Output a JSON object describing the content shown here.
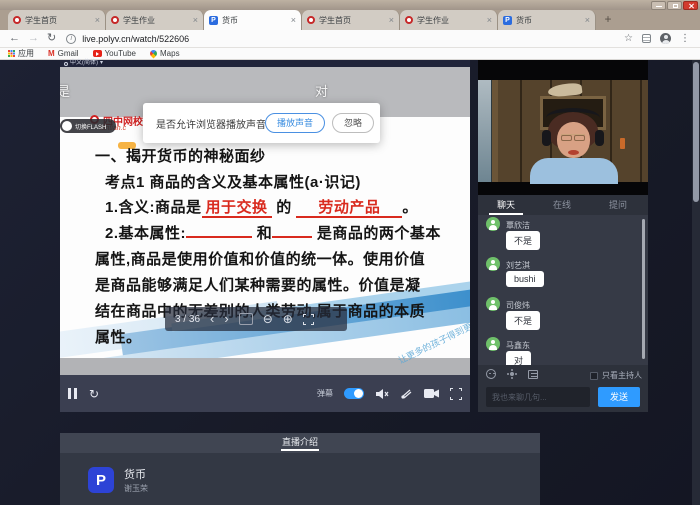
{
  "browser": {
    "tabs": [
      {
        "label": "学生首页"
      },
      {
        "label": "学生作业"
      },
      {
        "label": "货币"
      },
      {
        "label": "学生首页"
      },
      {
        "label": "学生作业"
      },
      {
        "label": "货币"
      }
    ],
    "url": "live.polyv.cn/watch/522606",
    "bookmarks": {
      "apps": "应用",
      "gmail": "Gmail",
      "youtube": "YouTube",
      "maps": "Maps",
      "gmail_letter": "M"
    }
  },
  "icons": {
    "back": "←",
    "forward": "→",
    "refresh": "↻",
    "info": "i",
    "star": "☆",
    "menu_dots": "⋮",
    "caret_down": "▾",
    "chevron_left": "‹",
    "chevron_right": "›",
    "zoom_out": "⊖",
    "zoom_in": "⊕",
    "close_tab": "×",
    "new_tab": "+"
  },
  "player": {
    "language": "中文(简体)",
    "danmaku": {
      "left_partial": "不是",
      "center": "对"
    },
    "flash_switch_label": "切换FLASH",
    "logo_text": "四中网校",
    "logo_domain": "lantian.c",
    "audio_dialog": {
      "question": "是否允许浏览器播放声音？",
      "play_button": "播放声音",
      "ignore_button": "忽略"
    },
    "slide": {
      "title": "一、揭开货币的神秘面纱",
      "subtitle": "考点1  商品的含义及基本属性(a·识记)",
      "line3_prefix": "1.含义:商品是",
      "line3_blank1": "用于交换",
      "line3_mid": "的",
      "line3_blank2": "劳动产品",
      "line3_suffix": "。",
      "line4_prefix": "2.基本属性:",
      "line4_mid": "和",
      "line4_suffix": "是商品的两个基本",
      "line5": "属性,商品是使用价值和价值的统一体。使用价值",
      "line6": "是商品能够满足人们某种需要的属性。价值是凝",
      "line7": "结在商品中的无差别的人类劳动,属于商品的本质",
      "line8": "属性。"
    },
    "pagination_label": "3 / 36",
    "diagonal_watermark": "让更多的孩子得到更好的教育",
    "controls": {
      "danmaku_label": "弹幕"
    }
  },
  "chat": {
    "tabs": [
      {
        "label": "聊天"
      },
      {
        "label": "在线"
      },
      {
        "label": "提问"
      }
    ],
    "messages": [
      {
        "name": "覃欣洁",
        "text": "不是"
      },
      {
        "name": "刘艺淇",
        "text": "bushi"
      },
      {
        "name": "司俊炜",
        "text": "不是"
      },
      {
        "name": "马鑫东",
        "text": "对"
      }
    ],
    "only_host_label": "只看主持人",
    "input_placeholder": "我也来聊几句...",
    "send_label": "发送"
  },
  "intro": {
    "tab_label": "直播介绍",
    "logo_letter": "P",
    "title": "货币",
    "teacher": "谢玉荣"
  },
  "colors": {
    "accent_blue": "#2f9bff",
    "avatar_green": "#6fc06a",
    "slide_red": "#d92a1e"
  }
}
